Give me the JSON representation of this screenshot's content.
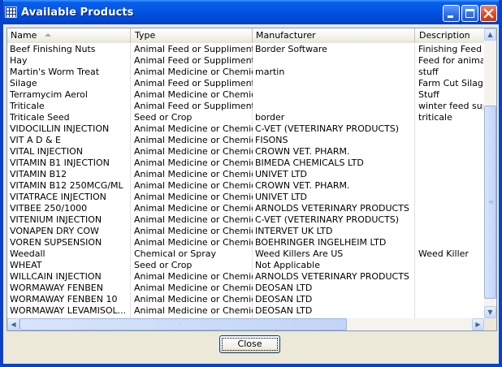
{
  "window": {
    "title": "Available Products",
    "icon": "grid-table-icon",
    "buttons": {
      "minimize": "minimize-icon",
      "maximize": "maximize-icon",
      "close": "close-icon"
    }
  },
  "table": {
    "columns": [
      {
        "label": "Name",
        "sorted": "ascending"
      },
      {
        "label": "Type"
      },
      {
        "label": "Manufacturer"
      },
      {
        "label": "Description"
      }
    ],
    "rows": [
      [
        "Beef Finishing Nuts",
        "Animal Feed or Suppliment",
        "Border Software",
        "Finishing Feed fo"
      ],
      [
        "Hay",
        "Animal Feed or Suppliment",
        "",
        "Feed for animals"
      ],
      [
        "Martin's Worm Treat",
        "Animal Medicine or Chemic...",
        "martin",
        "stuff"
      ],
      [
        "Silage",
        "Animal Feed or Suppliment",
        "",
        "Farm Cut Silage"
      ],
      [
        "Terramycim Aerol",
        "Animal Medicine or Chemic...",
        "",
        "Stuff"
      ],
      [
        "Triticale",
        "Animal Feed or Suppliment",
        "",
        "winter feed suplim"
      ],
      [
        "Triticale Seed",
        "Seed or Crop",
        "border",
        "triticale"
      ],
      [
        "VIDOCILLIN INJECTION",
        "Animal Medicine or Chemic...",
        "C-VET (VETERINARY PRODUCTS)",
        ""
      ],
      [
        "VIT A D & E",
        "Animal Medicine or Chemic...",
        "FISONS",
        ""
      ],
      [
        "VITAL INJECTION",
        "Animal Medicine or Chemic...",
        "CROWN VET. PHARM.",
        ""
      ],
      [
        "VITAMIN B1 INJECTION",
        "Animal Medicine or Chemic...",
        "BIMEDA CHEMICALS LTD",
        ""
      ],
      [
        "VITAMIN B12",
        "Animal Medicine or Chemic...",
        "UNIVET LTD",
        ""
      ],
      [
        "VITAMIN B12 250MCG/ML",
        "Animal Medicine or Chemic...",
        "CROWN VET. PHARM.",
        ""
      ],
      [
        "VITATRACE INJECTION",
        "Animal Medicine or Chemic...",
        "UNIVET LTD",
        ""
      ],
      [
        "VITBEE 250/1000",
        "Animal Medicine or Chemic...",
        "ARNOLDS VETERINARY PRODUCTS",
        ""
      ],
      [
        "VITENIUM INJECTION",
        "Animal Medicine or Chemic...",
        "C-VET (VETERINARY PRODUCTS)",
        ""
      ],
      [
        "VONAPEN DRY COW",
        "Animal Medicine or Chemic...",
        "INTERVET UK LTD",
        ""
      ],
      [
        "VOREN SUPSENSION",
        "Animal Medicine or Chemic...",
        "BOEHRINGER INGELHEIM LTD",
        ""
      ],
      [
        "Weedall",
        "Chemical or Spray",
        "Weed Killers Are US",
        "Weed Killer"
      ],
      [
        "WHEAT",
        "Seed or Crop",
        "Not Applicable",
        ""
      ],
      [
        "WILLCAIN INJECTION",
        "Animal Medicine or Chemic...",
        "ARNOLDS VETERINARY PRODUCTS",
        ""
      ],
      [
        "WORMAWAY FENBEN",
        "Animal Medicine or Chemic...",
        "DEOSAN LTD",
        ""
      ],
      [
        "WORMAWAY FENBEN 10",
        "Animal Medicine or Chemic...",
        "DEOSAN LTD",
        ""
      ],
      [
        "WORMAWAY LEVAMISOL...",
        "Animal Medicine or Chemic...",
        "DEOSAN LTD",
        ""
      ]
    ]
  },
  "scrollbars": {
    "vertical": {
      "position_fraction": 0.9
    },
    "horizontal": {
      "position_fraction": 0.0
    }
  },
  "footer": {
    "close_label": "Close"
  },
  "colors": {
    "titlebar": "#0055E5",
    "frame": "#0842C8",
    "dialog_bg": "#ECE9D8",
    "list_border": "#7F9DB9"
  }
}
